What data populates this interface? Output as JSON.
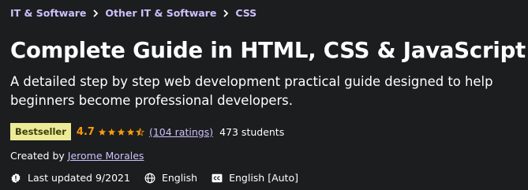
{
  "breadcrumb": {
    "items": [
      "IT & Software",
      "Other IT & Software",
      "CSS"
    ],
    "separator_icon": "chevron-right-icon"
  },
  "course": {
    "title": "Complete Guide in HTML, CSS & JavaScript",
    "subtitle": "A detailed step by step web development practical guide designed to help beginners become professional developers."
  },
  "rating": {
    "badge": "Bestseller",
    "value": "4.7",
    "stars_value": 4.5,
    "stars_max": 5,
    "ratings_link": "(104 ratings)",
    "students": "473 students"
  },
  "creator": {
    "prefix": "Created by",
    "name": "Jerome Morales"
  },
  "meta": {
    "last_updated": "Last updated 9/2021",
    "language": "English",
    "captions": "English [Auto]"
  },
  "colors": {
    "background": "#1c1d1f",
    "link_purple": "#cec0fc",
    "star_orange": "#f69c08",
    "badge_yellow": "#eceb98",
    "badge_text": "#3d3c0a"
  }
}
